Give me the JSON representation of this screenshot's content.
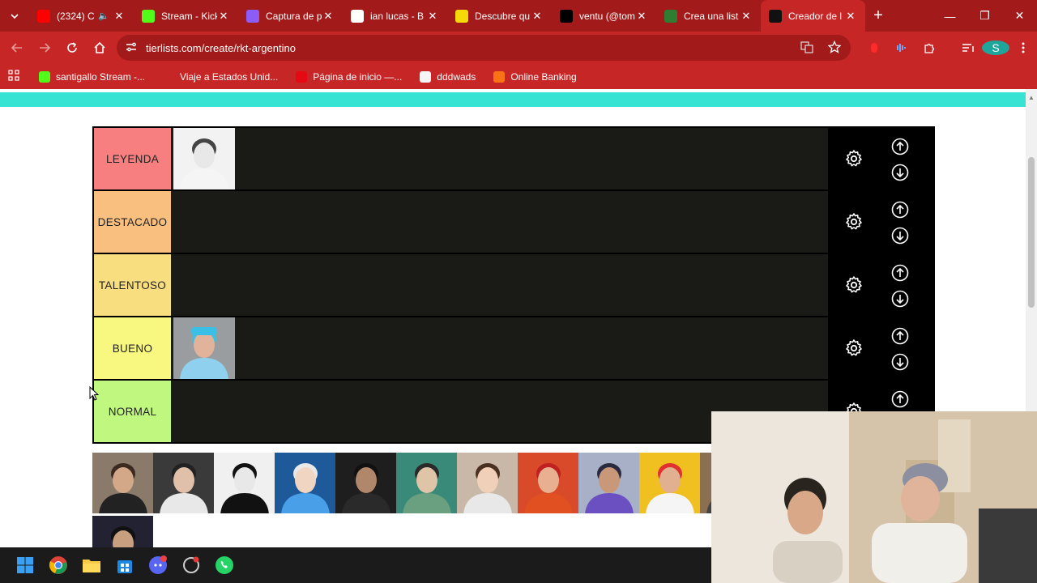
{
  "tabs": [
    {
      "title": "(2324) C",
      "icon": "youtube-icon",
      "color": "#ff0000",
      "muted_icon": true
    },
    {
      "title": "Stream - Kick",
      "icon": "kick-icon",
      "color": "#53fc18"
    },
    {
      "title": "Captura de p",
      "icon": "feather-icon",
      "color": "#8b5cf6"
    },
    {
      "title": "ian lucas - B",
      "icon": "google-icon",
      "color": "#ffffff"
    },
    {
      "title": "Descubre qu",
      "icon": "star-badge-icon",
      "color": "#f5d90a"
    },
    {
      "title": "ventu (@tom",
      "icon": "tiktok-icon",
      "color": "#000000"
    },
    {
      "title": "Crea una list",
      "icon": "list-app-icon",
      "color": "#2e7d32"
    },
    {
      "title": "Creador de l",
      "icon": "tierlist-icon",
      "color": "#111111",
      "active": true
    }
  ],
  "address": {
    "url": "tierlists.com/create/rkt-argentino"
  },
  "bookmarks": [
    {
      "label": "santigallo Stream -...",
      "icon": "kick-icon",
      "color": "#53fc18"
    },
    {
      "label": "Viaje a Estados Unid...",
      "icon": "globe-icon",
      "color": "#c62626"
    },
    {
      "label": "Página de inicio —...",
      "icon": "netflix-icon",
      "color": "#e50914"
    },
    {
      "label": "dddwads",
      "icon": "puzzle-icon",
      "color": "#f5f5f5"
    },
    {
      "label": "Online Banking",
      "icon": "bank-icon",
      "color": "#f97316"
    }
  ],
  "tiers": [
    {
      "label": "LEYENDA",
      "color": "#f87f7f",
      "items": [
        "player-photo-1"
      ]
    },
    {
      "label": "DESTACADO",
      "color": "#f8bf7f",
      "items": []
    },
    {
      "label": "TALENTOSO",
      "color": "#f8de7f",
      "items": []
    },
    {
      "label": "BUENO",
      "color": "#f8f77f",
      "items": [
        "player-photo-2"
      ]
    },
    {
      "label": "NORMAL",
      "color": "#bff77f",
      "items": []
    }
  ],
  "colors": {
    "chrome_dark": "#a31a1a",
    "chrome": "#c62626",
    "strip": "#39e3d3",
    "tier_bg": "#1a1a17"
  }
}
